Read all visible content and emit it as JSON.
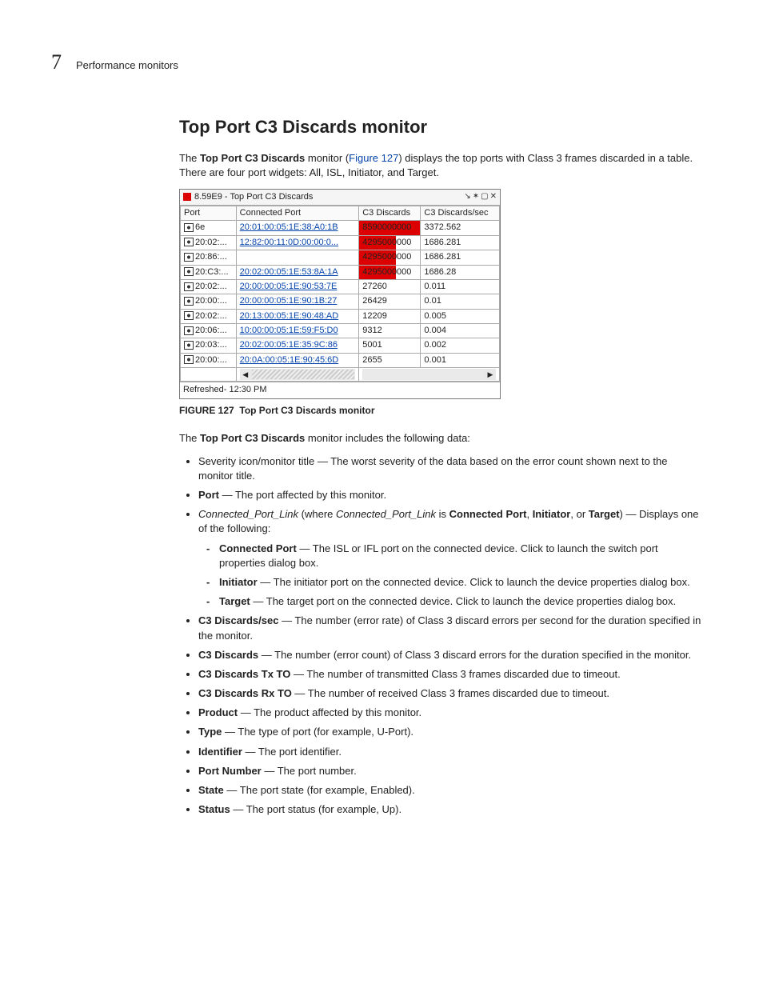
{
  "header": {
    "chapter_number": "7",
    "chapter_label": "Performance monitors"
  },
  "section": {
    "title": "Top Port C3 Discards monitor",
    "intro_pre": "The ",
    "intro_bold": "Top Port C3 Discards",
    "intro_mid": " monitor (",
    "intro_link": "Figure 127",
    "intro_post": ") displays the top ports with Class 3 frames discarded in a table. There are four port widgets: All, ISL, Initiator, and Target."
  },
  "widget": {
    "title": "8.59E9 - Top Port C3 Discards",
    "icons": [
      "↘",
      "✶",
      "▢",
      "✕"
    ],
    "columns": [
      "Port",
      "Connected Port",
      "C3 Discards",
      "C3 Discards/sec"
    ],
    "rows": [
      {
        "port": "6e",
        "conn": "20:01:00:05:1E:38:A0:1B",
        "discards": "8590000000",
        "rate": "3372.562",
        "bar": 100
      },
      {
        "port": "20:02:...",
        "conn": "12:82:00:11:0D:00:00:0...",
        "discards": "4295000000",
        "rate": "1686.281",
        "bar": 60
      },
      {
        "port": "20:86:...",
        "conn": "",
        "discards": "4295000000",
        "rate": "1686.281",
        "bar": 60
      },
      {
        "port": "20:C3:...",
        "conn": "20:02:00:05:1E:53:8A:1A",
        "discards": "4295000000",
        "rate": "1686.28",
        "bar": 60
      },
      {
        "port": "20:02:...",
        "conn": "20:00:00:05:1E:90:53:7E",
        "discards": "27260",
        "rate": "0.011",
        "bar": 0
      },
      {
        "port": "20:00:...",
        "conn": "20:00:00:05:1E:90:1B:27",
        "discards": "26429",
        "rate": "0.01",
        "bar": 0
      },
      {
        "port": "20:02:...",
        "conn": "20:13:00:05:1E:90:48:AD",
        "discards": "12209",
        "rate": "0.005",
        "bar": 0
      },
      {
        "port": "20:06:...",
        "conn": "10:00:00:05:1E:59:F5:D0",
        "discards": "9312",
        "rate": "0.004",
        "bar": 0
      },
      {
        "port": "20:03:...",
        "conn": "20:02:00:05:1E:35:9C:86",
        "discards": "5001",
        "rate": "0.002",
        "bar": 0
      },
      {
        "port": "20:00:...",
        "conn": "20:0A:00:05:1E:90:45:6D",
        "discards": "2655",
        "rate": "0.001",
        "bar": 0
      }
    ],
    "scroll_left": "◀",
    "scroll_right": "▶",
    "status": "Refreshed- 12:30 PM"
  },
  "figure": {
    "label": "FIGURE 127",
    "title": "Top Port C3 Discards monitor"
  },
  "intro_list": {
    "lead_pre": "The ",
    "lead_bold": "Top Port C3 Discards",
    "lead_post": " monitor includes the following data:"
  },
  "bullets": [
    {
      "plain": "Severity icon/monitor title — The worst severity of the data based on the error count shown next to the monitor title."
    },
    {
      "term": "Port",
      "rest": " — The port affected by this monitor."
    },
    {
      "cpl": true
    },
    {
      "sub": [
        {
          "term": "Connected Port",
          "rest": " — The ISL or IFL port on the connected device. Click to launch the switch port properties dialog box."
        },
        {
          "term": "Initiator",
          "rest": " — The initiator port on the connected device. Click to launch the device properties dialog box."
        },
        {
          "term": "Target",
          "rest": " — The target port on the connected device. Click to launch the device properties dialog box."
        }
      ]
    },
    {
      "term": "C3 Discards/sec",
      "rest": " — The number (error rate) of Class 3 discard errors per second for the duration specified in the monitor."
    },
    {
      "term": "C3 Discards",
      "rest": " — The number (error count) of Class 3 discard errors for the duration specified in the monitor."
    },
    {
      "term": "C3 Discards Tx TO",
      "rest": " — The number of transmitted Class 3 frames discarded due to timeout."
    },
    {
      "term": "C3 Discards Rx TO",
      "rest": " — The number of received Class 3 frames discarded due to timeout."
    },
    {
      "term": "Product",
      "rest": " — The product affected by this monitor."
    },
    {
      "term": "Type",
      "rest": " — The type of port (for example, U-Port)."
    },
    {
      "term": "Identifier",
      "rest": " — The port identifier."
    },
    {
      "term": "Port Number",
      "rest": " — The port number."
    },
    {
      "term": "State",
      "rest": " — The port state (for example, Enabled)."
    },
    {
      "term": "Status",
      "rest": " — The port status (for example, Up)."
    }
  ],
  "cpl_text": {
    "i1": "Connected_Port_Link",
    "t1": " (where ",
    "i2": "Connected_Port_Link",
    "t2": " is ",
    "b1": "Connected Port",
    "t3": ", ",
    "b2": "Initiator",
    "t4": ", or ",
    "b3": "Target",
    "t5": ") — Displays one of the following:"
  }
}
